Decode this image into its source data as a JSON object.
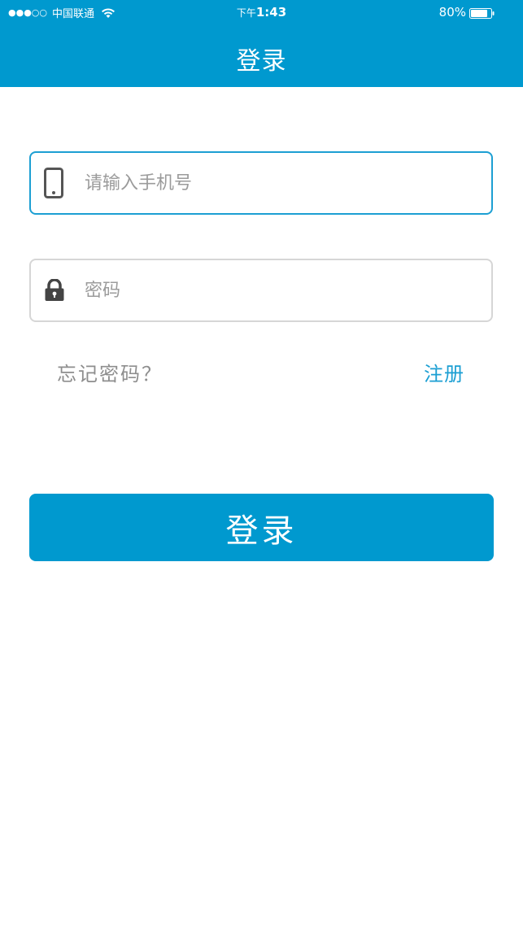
{
  "status_bar": {
    "signal": "●●●○○",
    "carrier": "中国联通",
    "time_prefix": "下午",
    "time": "1:43",
    "battery": "80%"
  },
  "nav": {
    "title": "登录"
  },
  "form": {
    "phone": {
      "placeholder": "请输入手机号",
      "value": "",
      "icon": "phone-icon"
    },
    "password": {
      "placeholder": "密码",
      "value": "",
      "icon": "lock-icon"
    },
    "forgot_label": "忘记密码？",
    "register_label": "注册",
    "login_label": "登录"
  },
  "colors": {
    "brand": "#0099cf",
    "accent": "#1c9fd3",
    "muted_text": "#8e8e8e",
    "border_inactive": "#d6d6d6"
  }
}
